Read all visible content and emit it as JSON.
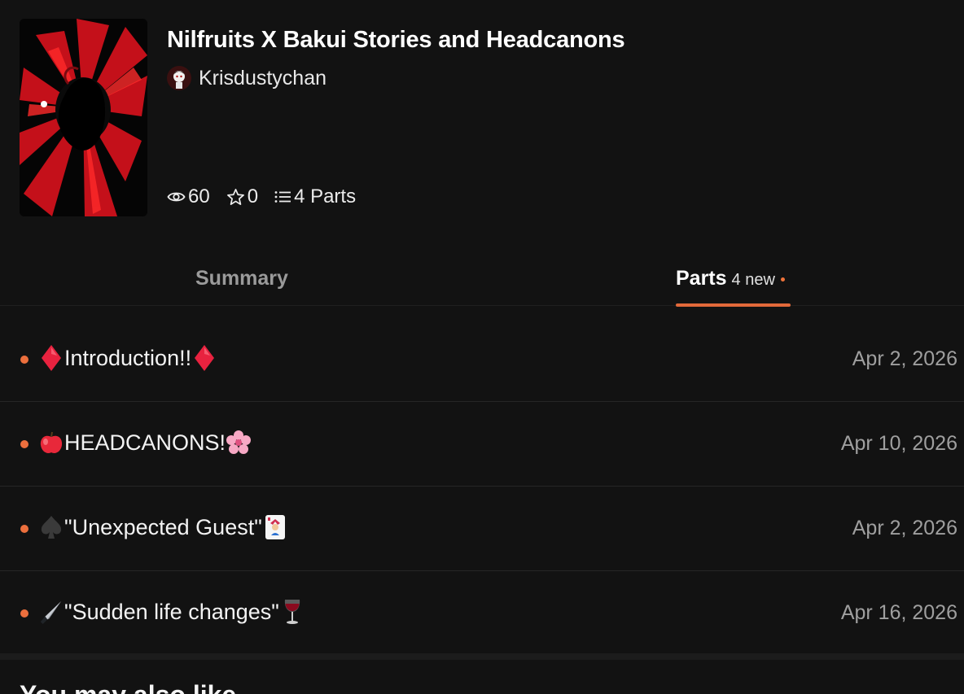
{
  "story": {
    "title": "Nilfruits X Bakui Stories and Headcanons",
    "author": "Krisdustychan",
    "stats": {
      "reads": "60",
      "votes": "0",
      "parts": "4 Parts"
    },
    "cover_icon": "red-spiral-figure-cover-art"
  },
  "tabs": {
    "summary_label": "Summary",
    "parts_label": "Parts",
    "parts_new": "4 new"
  },
  "parts": [
    {
      "title": "Introduction!!",
      "date": "Apr 2, 2026",
      "lead_icon": "red-diamond-icon",
      "trail_icon": "red-diamond-icon"
    },
    {
      "title": "HEADCANONS!",
      "date": "Apr 10, 2026",
      "lead_icon": "red-apple-icon",
      "trail_icon": "cherry-blossom-icon"
    },
    {
      "title": "\"Unexpected Guest\"",
      "date": "Apr 2, 2026",
      "lead_icon": "spade-icon",
      "trail_icon": "joker-card-icon"
    },
    {
      "title": "\"Sudden life changes\" ",
      "date": "Apr 16, 2026",
      "lead_icon": "knife-icon",
      "trail_icon": "wine-glass-icon"
    }
  ],
  "next_section": {
    "heading": "You may also like"
  },
  "colors": {
    "background": "#121212",
    "accent": "#e2693a",
    "new_dot": "#ec6f3d",
    "muted_text": "#9f9f9f"
  }
}
